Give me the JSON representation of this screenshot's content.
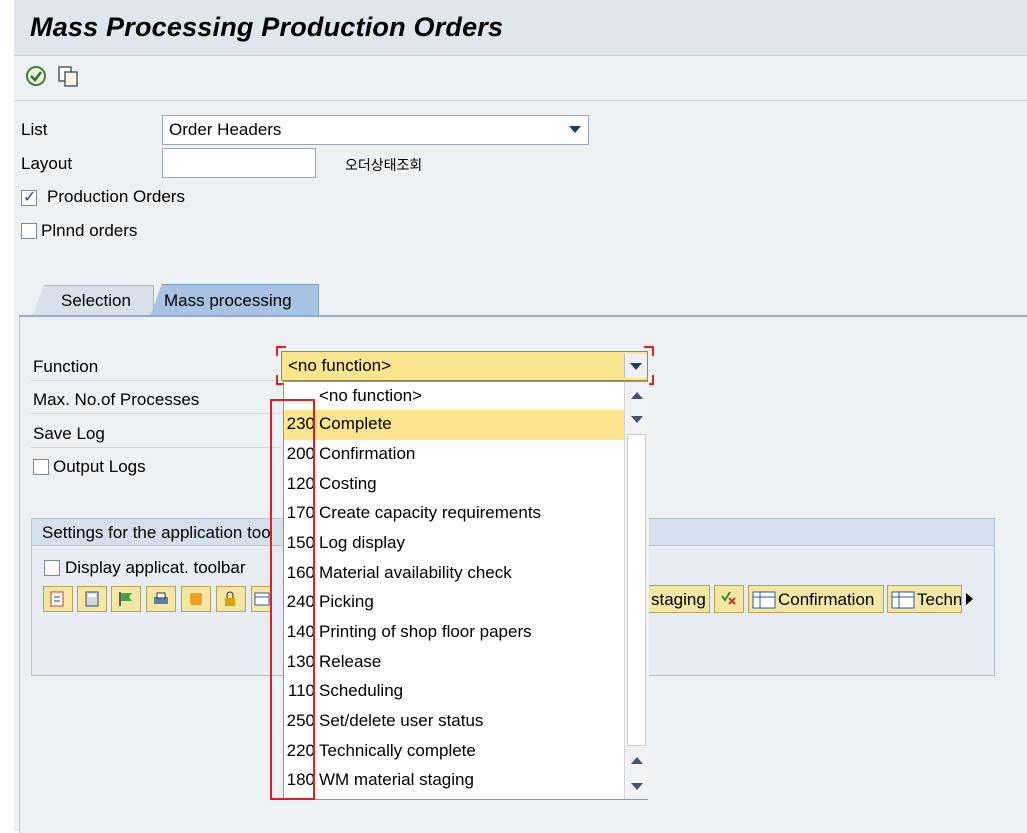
{
  "title": "Mass Processing Production Orders",
  "toolbar": {
    "icons": [
      "execute-icon",
      "copy-variant-icon"
    ]
  },
  "header": {
    "list_label": "List",
    "list_value": "Order Headers",
    "layout_label": "Layout",
    "layout_value": "",
    "layout_desc": "오더상태조회",
    "production_orders_label": "Production Orders",
    "production_orders_checked": true,
    "planned_orders_label": "Plnnd orders",
    "planned_orders_checked": false
  },
  "tabs": [
    {
      "label": "Selection",
      "active": false
    },
    {
      "label": "Mass processing",
      "active": true
    }
  ],
  "mass": {
    "function_label": "Function",
    "function_value": "<no function>",
    "max_processes_label": "Max. No.of Processes",
    "save_log_label": "Save Log",
    "output_logs_label": "Output Logs",
    "settings_title": "Settings for the application too",
    "display_toolbar_label": "Display applicat. toolbar",
    "staging_button": "staging",
    "confirmation_button": "Confirmation",
    "techn_button": "Techn"
  },
  "dropdown": {
    "options": [
      {
        "code": "",
        "label": "<no function>"
      },
      {
        "code": "230",
        "label": "Complete",
        "selected": true
      },
      {
        "code": "200",
        "label": "Confirmation"
      },
      {
        "code": "120",
        "label": "Costing"
      },
      {
        "code": "170",
        "label": "Create capacity requirements"
      },
      {
        "code": "150",
        "label": "Log display"
      },
      {
        "code": "160",
        "label": "Material availability check"
      },
      {
        "code": "240",
        "label": "Picking"
      },
      {
        "code": "140",
        "label": "Printing of shop floor papers"
      },
      {
        "code": "130",
        "label": "Release"
      },
      {
        "code": "110",
        "label": "Scheduling"
      },
      {
        "code": "250",
        "label": "Set/delete user status"
      },
      {
        "code": "220",
        "label": "Technically complete"
      },
      {
        "code": "180",
        "label": "WM material staging"
      }
    ]
  },
  "colors": {
    "highlight": "#e02020",
    "selected_option": "#fde48f",
    "active_tab": "#a7c3e1"
  }
}
